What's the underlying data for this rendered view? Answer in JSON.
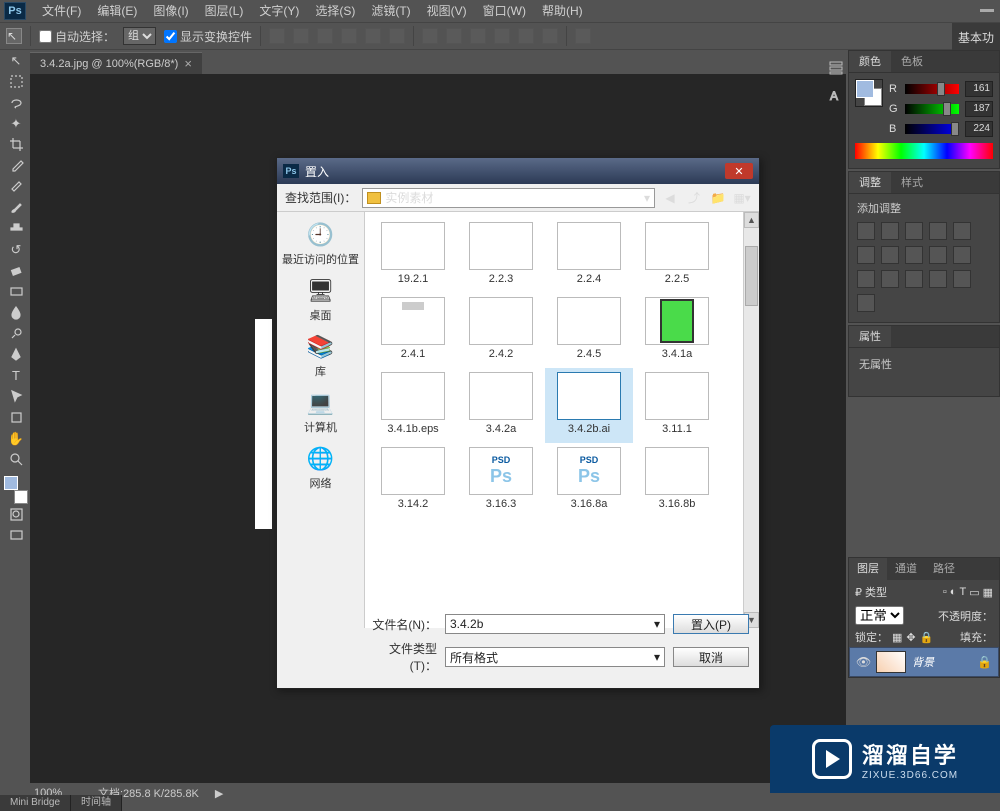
{
  "menu": {
    "items": [
      "文件(F)",
      "编辑(E)",
      "图像(I)",
      "图层(L)",
      "文字(Y)",
      "选择(S)",
      "滤镜(T)",
      "视图(V)",
      "窗口(W)",
      "帮助(H)"
    ]
  },
  "optbar": {
    "auto_select": "自动选择：",
    "group": "组",
    "show_transform": "显示变换控件",
    "right_label": "基本功"
  },
  "doc_tab": "3.4.2a.jpg @ 100%(RGB/8*)",
  "color_panel": {
    "tabs": [
      "颜色",
      "色板"
    ],
    "r": "R",
    "g": "G",
    "b": "B",
    "rv": "161",
    "gv": "187",
    "bv": "224"
  },
  "adjust_panel": {
    "tabs": [
      "调整",
      "样式"
    ],
    "title": "添加调整"
  },
  "prop_panel": {
    "tabs": [
      "属性"
    ],
    "text": "无属性"
  },
  "layers_panel": {
    "tabs": [
      "图层",
      "通道",
      "路径"
    ],
    "kind_label": "₽ 类型",
    "blend": "正常",
    "opacity_label": "不透明度：",
    "lock_label": "锁定：",
    "fill_label": "填充：",
    "layer_name": "背景"
  },
  "status": {
    "zoom": "100%",
    "doc_size": "文档:285.8 K/285.8K"
  },
  "bottom_tabs": [
    "Mini Bridge",
    "时间轴"
  ],
  "dialog": {
    "title": "置入",
    "lookin_label": "查找范围(I)：",
    "folder": "实例素材",
    "sidebar": [
      {
        "label": "最近访问的位置"
      },
      {
        "label": "桌面"
      },
      {
        "label": "库"
      },
      {
        "label": "计算机"
      },
      {
        "label": "网络"
      }
    ],
    "files": [
      {
        "name": "19.2.1",
        "cls": "th-1"
      },
      {
        "name": "2.2.3",
        "cls": "th-2"
      },
      {
        "name": "2.2.4",
        "cls": "th-3"
      },
      {
        "name": "2.2.5",
        "cls": "th-4"
      },
      {
        "name": "2.4.1",
        "cls": "th-floppy"
      },
      {
        "name": "2.4.2",
        "cls": "th-flower"
      },
      {
        "name": "2.4.5",
        "cls": "th-room"
      },
      {
        "name": "3.4.1a",
        "cls": "th-phone"
      },
      {
        "name": "3.4.1b.eps",
        "cls": "th-blank"
      },
      {
        "name": "3.4.2a",
        "cls": "th-face"
      },
      {
        "name": "3.4.2b.ai",
        "cls": "th-blank",
        "selected": true
      },
      {
        "name": "3.11.1",
        "cls": "th-palm"
      },
      {
        "name": "3.14.2",
        "cls": "th-shelf"
      },
      {
        "name": "3.16.3",
        "cls": "th-ps",
        "ps": true
      },
      {
        "name": "3.16.8a",
        "cls": "th-ps",
        "ps": true
      },
      {
        "name": "3.16.8b",
        "cls": "th-dark"
      }
    ],
    "filename_label": "文件名(N)：",
    "filename_value": "3.4.2b",
    "filetype_label": "文件类型(T)：",
    "filetype_value": "所有格式",
    "place_btn": "置入(P)",
    "cancel_btn": "取消"
  },
  "watermark": {
    "big": "溜溜自学",
    "small": "ZIXUE.3D66.COM"
  }
}
